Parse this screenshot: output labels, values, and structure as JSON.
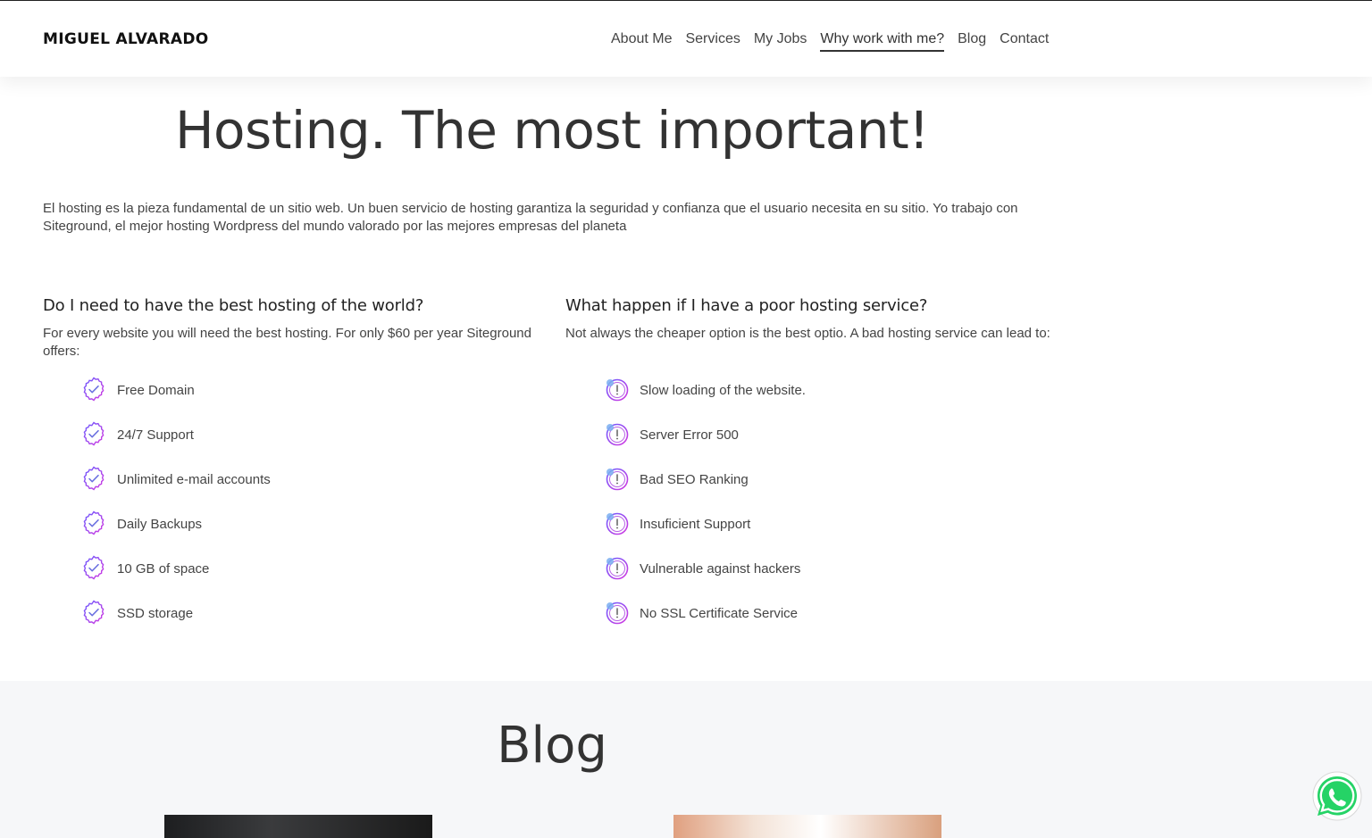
{
  "header": {
    "logo": "MIGUEL ALVARADO",
    "nav": [
      {
        "label": "About Me"
      },
      {
        "label": "Services"
      },
      {
        "label": "My Jobs"
      },
      {
        "label": "Why work with me?"
      },
      {
        "label": "Blog"
      },
      {
        "label": "Contact"
      }
    ],
    "active_nav": "Why work with me?"
  },
  "hero": {
    "title": "Hosting. The most important!",
    "intro": "El hosting es la pieza fundamental de un sitio web. Un buen servicio de hosting garantiza la seguridad y confianza que el usuario necesita en su sitio. Yo trabajo con Siteground, el mejor hosting Wordpress del mundo valorado por las mejores empresas del planeta"
  },
  "left_column": {
    "heading": "Do I need to have the best hosting of the world?",
    "description": "For every website you will need the best hosting. For only $60 per year Siteground offers:",
    "icon": "check-circle-icon",
    "items": [
      {
        "label": "Free Domain"
      },
      {
        "label": "24/7 Support"
      },
      {
        "label": "Unlimited e-mail accounts"
      },
      {
        "label": "Daily Backups"
      },
      {
        "label": "10 GB of space"
      },
      {
        "label": "SSD storage"
      }
    ]
  },
  "right_column": {
    "heading": "What happen if I have a poor hosting service?",
    "description": "Not always the cheaper option is the best optio. A bad hosting service can lead to:",
    "icon": "warning-circle-icon",
    "items": [
      {
        "label": "Slow loading of the website."
      },
      {
        "label": "Server Error 500"
      },
      {
        "label": "Bad SEO Ranking"
      },
      {
        "label": "Insuficient Support"
      },
      {
        "label": "Vulnerable against hackers"
      },
      {
        "label": "No SSL Certificate Service"
      }
    ]
  },
  "blog": {
    "title": "Blog"
  },
  "colors": {
    "accent_gradient_start": "#6a5cff",
    "accent_gradient_end": "#d438e0",
    "whatsapp_green": "#25d366",
    "blog_bg": "#f6f7f9"
  },
  "floating": {
    "icon": "whatsapp-icon"
  }
}
